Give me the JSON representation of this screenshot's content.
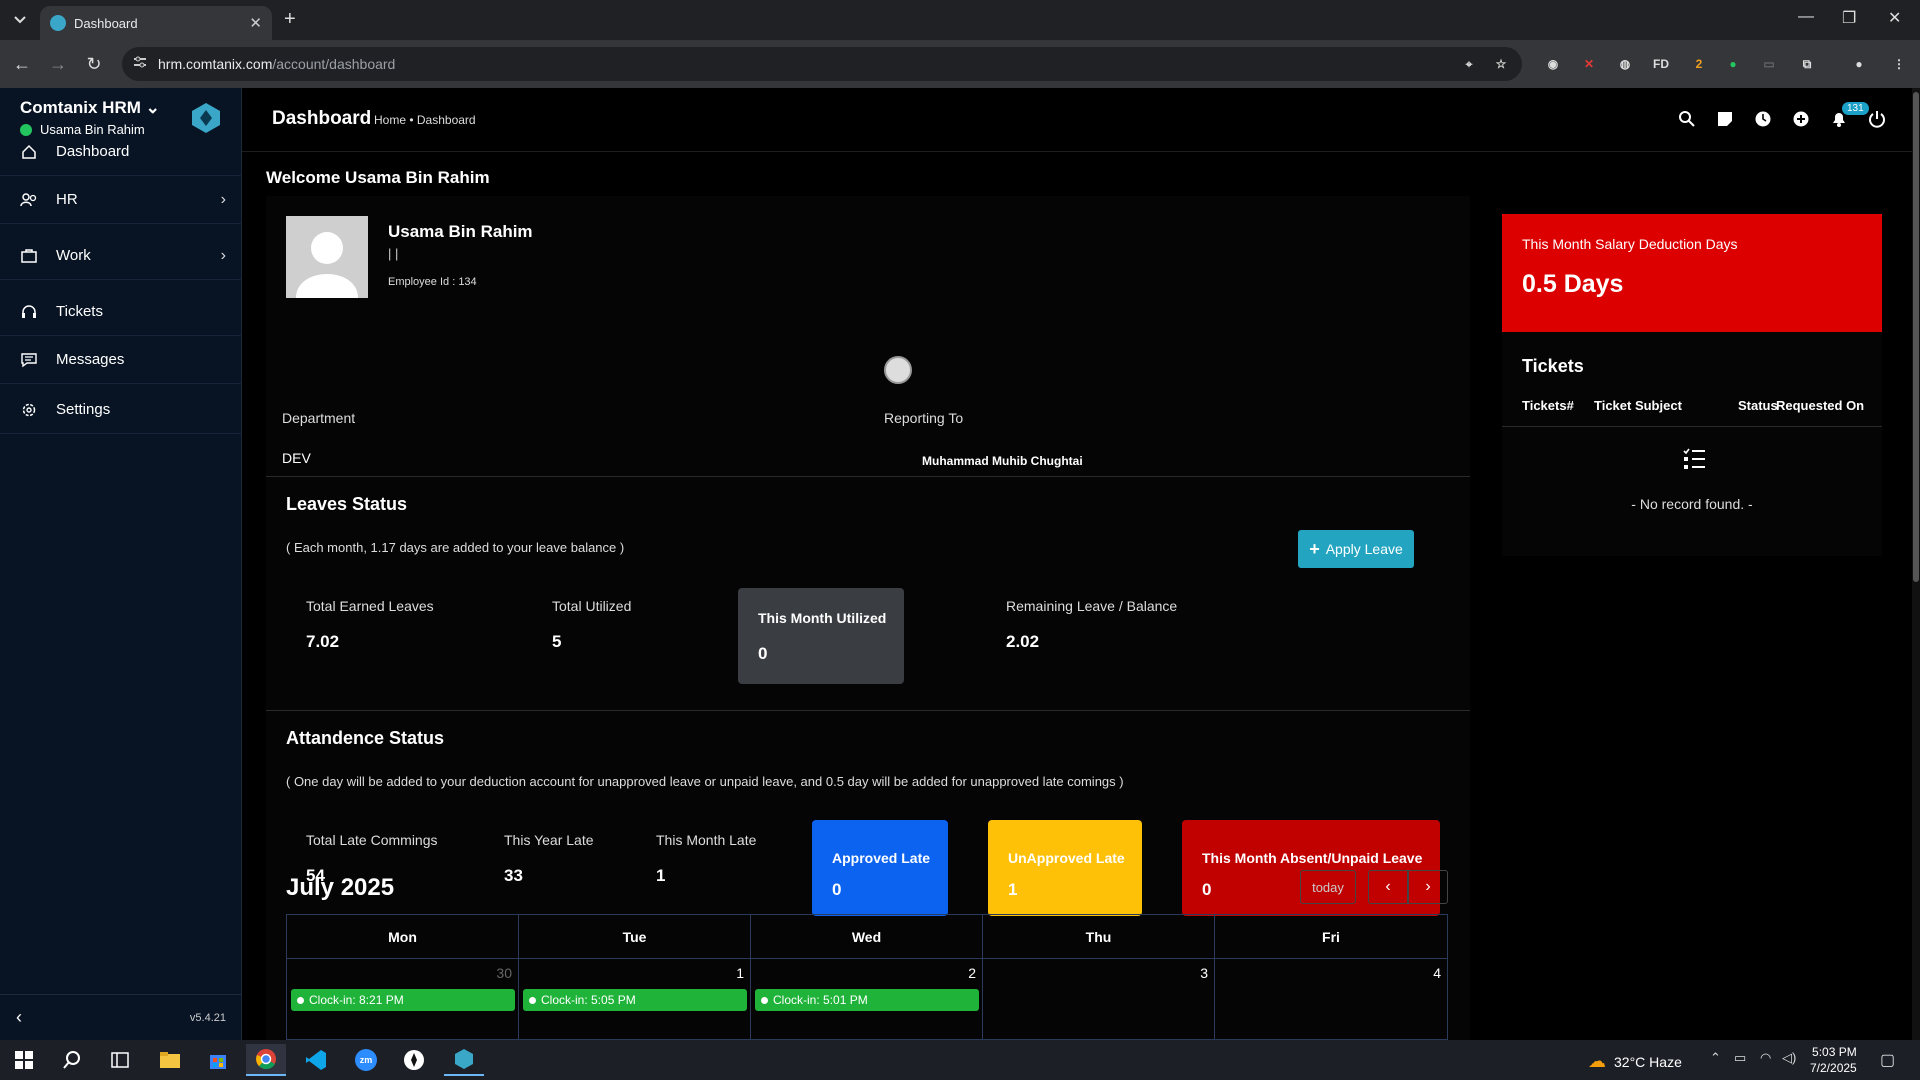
{
  "browser": {
    "tab_title": "Dashboard",
    "url_domain": "hrm.comtanix.com",
    "url_path": "/account/dashboard",
    "ext_labels": {
      "fd": "FD",
      "badge": "2"
    }
  },
  "sidebar": {
    "brand": "Comtanix HRM",
    "user": "Usama Bin Rahim",
    "items": [
      {
        "label": "Dashboard",
        "icon": "home-icon"
      },
      {
        "label": "HR",
        "icon": "users-icon"
      },
      {
        "label": "Work",
        "icon": "briefcase-icon"
      },
      {
        "label": "Tickets",
        "icon": "headset-icon"
      },
      {
        "label": "Messages",
        "icon": "message-icon"
      },
      {
        "label": "Settings",
        "icon": "gear-icon"
      }
    ],
    "version": "v5.4.21"
  },
  "topbar": {
    "title": "Dashboard",
    "breadcrumb": "Home • Dashboard",
    "notif_count": "131"
  },
  "welcome": "Welcome Usama Bin Rahim",
  "profile": {
    "name": "Usama Bin Rahim",
    "subtitle": "| |",
    "employee_id": "Employee Id : 134",
    "department_label": "Department",
    "department": "DEV",
    "reporting_label": "Reporting To",
    "reporting_to": "Muhammad Muhib Chughtai"
  },
  "leaves": {
    "title": "Leaves Status",
    "note": "( Each month, 1.17 days are added to your leave balance )",
    "earned_label": "Total Earned Leaves",
    "earned": "7.02",
    "utilized_label": "Total Utilized",
    "utilized": "5",
    "month_label": "This Month Utilized",
    "month": "0",
    "remaining_label": "Remaining Leave / Balance",
    "remaining": "2.02",
    "apply_label": "Apply Leave"
  },
  "attendance": {
    "title": "Attandence Status",
    "note": "( One day will be added to your deduction account for unapproved leave or unpaid leave, and 0.5 day will be added for unapproved late comings )",
    "late_label": "Total Late Commings",
    "late": "54",
    "year_label": "This Year Late",
    "year": "33",
    "month_label": "This Month Late",
    "month": "1",
    "approved_label": "Approved Late",
    "approved": "0",
    "unapproved_label": "UnApproved Late",
    "unapproved": "1",
    "absent_label": "This Month Absent/Unpaid Leave",
    "absent": "0",
    "colors": {
      "approved": "#0b63f0",
      "unapproved": "#ffc107",
      "absent": "#c10000"
    }
  },
  "calendar": {
    "title": "July 2025",
    "today_label": "today",
    "days": [
      "Mon",
      "Tue",
      "Wed",
      "Thu",
      "Fri"
    ],
    "dates": [
      "30",
      "1",
      "2",
      "3",
      "4"
    ],
    "events": [
      "Clock-in: 8:21 PM",
      "Clock-in: 5:05 PM",
      "Clock-in: 5:01 PM"
    ]
  },
  "deduction": {
    "title": "This Month Salary Deduction Days",
    "value": "0.5 Days"
  },
  "tickets": {
    "title": "Tickets",
    "columns": [
      "Tickets#",
      "Ticket Subject",
      "Status",
      "Requested On"
    ],
    "empty": "- No record found. -"
  },
  "taskbar": {
    "weather": "32°C  Haze",
    "time": "5:03 PM",
    "date": "7/2/2025",
    "zoom_label": "zm"
  }
}
